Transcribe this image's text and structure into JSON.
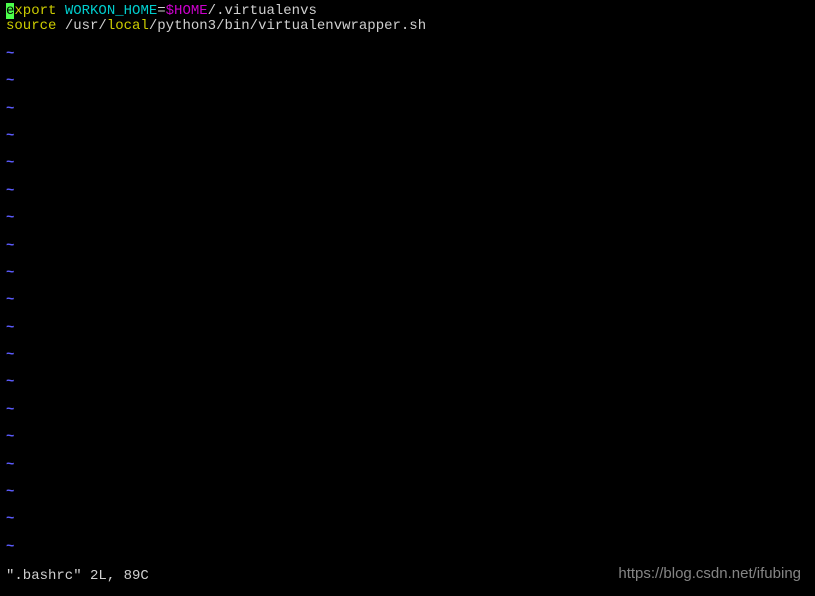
{
  "editor": {
    "line1": {
      "cursor_char": "e",
      "keyword_rest": "xport",
      "space1": " ",
      "var_name": "WORKON_HOME",
      "eq": "=",
      "var_ref": "$HOME",
      "path": "/.virtualenvs"
    },
    "line2": {
      "keyword": "source",
      "space": " ",
      "path1": "/usr/",
      "highlight": "local",
      "path2": "/python3/bin/virtualenvwrapper.sh"
    },
    "tilde": "~",
    "tilde_count": 19,
    "status": "\".bashrc\" 2L, 89C"
  },
  "watermark": "https://blog.csdn.net/ifubing"
}
